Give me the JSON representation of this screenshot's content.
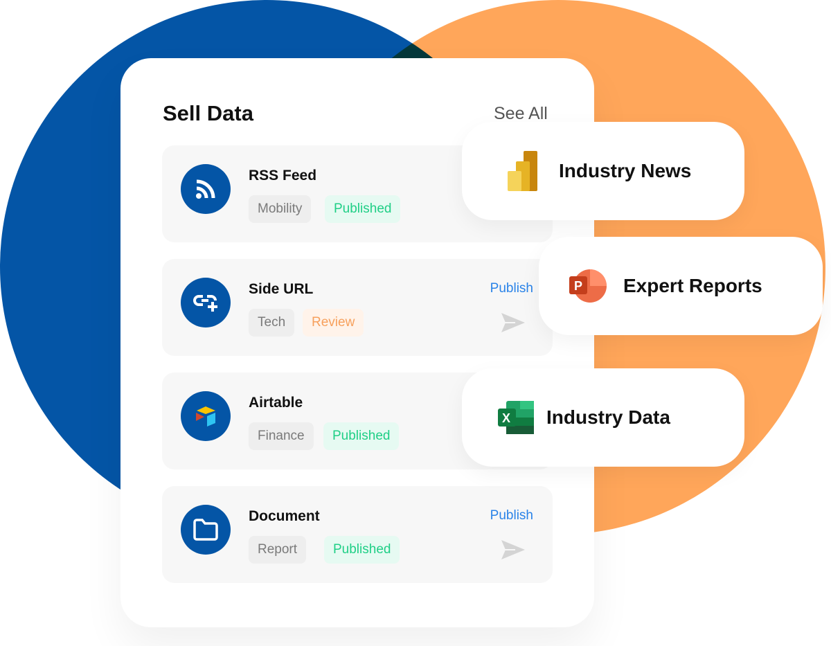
{
  "card": {
    "title": "Sell Data",
    "see_all": "See All",
    "rows": [
      {
        "name": "RSS Feed",
        "category": "Mobility",
        "status": "Published",
        "icon": "rss-icon"
      },
      {
        "name": "Side URL",
        "category": "Tech",
        "status": "Review",
        "action": "Publish",
        "icon": "link-add-icon"
      },
      {
        "name": "Airtable",
        "category": "Finance",
        "status": "Published",
        "icon": "airtable-icon"
      },
      {
        "name": "Document",
        "category": "Report",
        "status": "Published",
        "action": "Publish",
        "icon": "folder-icon"
      }
    ]
  },
  "pills": [
    {
      "label": "Industry News",
      "icon": "power-bi-icon"
    },
    {
      "label": "Expert Reports",
      "icon": "powerpoint-icon"
    },
    {
      "label": "Industry Data",
      "icon": "excel-icon"
    }
  ],
  "colors": {
    "brand_blue": "#0455a6",
    "accent_orange": "#ffa65a",
    "published_green": "#1fcf86",
    "review_orange": "#f7a05c",
    "link_blue": "#2a83e8"
  }
}
